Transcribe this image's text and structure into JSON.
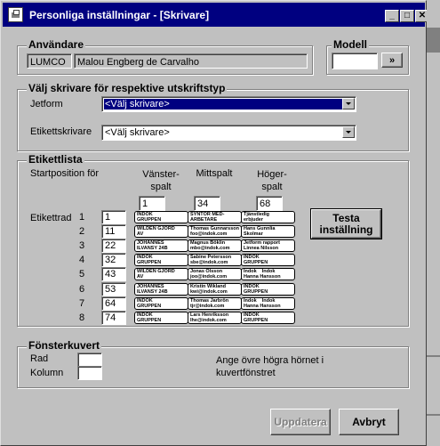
{
  "window": {
    "title": "Personliga inställningar - [Skrivare]",
    "controls": {
      "minimize": "_",
      "maximize": "□",
      "close": "✕"
    }
  },
  "user": {
    "legend": "Användare",
    "code": "LUMCO",
    "name": "Malou Engberg de Carvalho"
  },
  "model": {
    "legend": "Modell",
    "value": "",
    "button": "»"
  },
  "printers": {
    "legend": "Välj skrivare för respektive utskriftstyp",
    "jetform_label": "Jetform",
    "jetform_value": "<Välj skrivare>",
    "label_printer_label": "Etikettskrivare",
    "label_printer_value": "<Välj skrivare>"
  },
  "labels": {
    "legend": "Etikettlista",
    "start_position_label": "Startposition för",
    "columns": [
      {
        "header": "Vänster-\nspalt",
        "value": "1"
      },
      {
        "header": "Mittspalt",
        "value": "34"
      },
      {
        "header": "Höger-\nspalt",
        "value": "68"
      }
    ],
    "row_title": "Etikettrad",
    "rows": [
      {
        "num": "1",
        "value": "1",
        "cards": [
          "INDOK\nGRUPPEN",
          "SYNTOR MED-\nARBETARE",
          "Tjänstledig\nerbjuder"
        ]
      },
      {
        "num": "2",
        "value": "11",
        "cards": [
          "WILDEN GJORD\nAV",
          "Thomas Gunnarsson\nfoo@indok.com",
          "Hans Gunnlia\nSkolmar"
        ]
      },
      {
        "num": "3",
        "value": "22",
        "cards": [
          "JOHANNES\nILVANSY 24B",
          "Magnus Böklin\nmbo@indok.com",
          "Jetform rapport\nLinnea Nilsson"
        ]
      },
      {
        "num": "4",
        "value": "32",
        "cards": [
          "INDOK\nGRUPPEN",
          "Sabine Petersson\nsbe@indok.com",
          "INDOK\nGRUPPEN"
        ]
      },
      {
        "num": "5",
        "value": "43",
        "cards": [
          "WILDEN GJORD\nAV",
          "Jonas Olsson\njoo@indok.com",
          "Indok    Indok\nHanna Hansson"
        ]
      },
      {
        "num": "6",
        "value": "53",
        "cards": [
          "JOHANNES\nILVANSY 24B",
          "Kristin Wikland\nkwi@indok.com",
          "INDOK\nGRUPPEN"
        ]
      },
      {
        "num": "7",
        "value": "64",
        "cards": [
          "INDOK\nGRUPPEN",
          "Thomas Jarbrön\ntjr@indok.com",
          "Indok    Indok\nHanna Hansson"
        ]
      },
      {
        "num": "8",
        "value": "74",
        "cards": [
          "INDOK\nGRUPPEN",
          "Lars Henriksson\nlhe@indok.com",
          "INDOK\nGRUPPEN"
        ]
      }
    ],
    "test_button": "Testa\ninställning"
  },
  "envelope": {
    "legend": "Fönsterkuvert",
    "row_label": "Rad",
    "column_label": "Kolumn",
    "row_value": "",
    "column_value": "",
    "hint": "Ange övre högra hörnet i\nkuvertfönstret"
  },
  "actions": {
    "update": "Uppdatera",
    "cancel": "Avbryt"
  },
  "colors": {
    "titlebar": "#000080",
    "face": "#c0c0c0",
    "selection": "#000080"
  }
}
